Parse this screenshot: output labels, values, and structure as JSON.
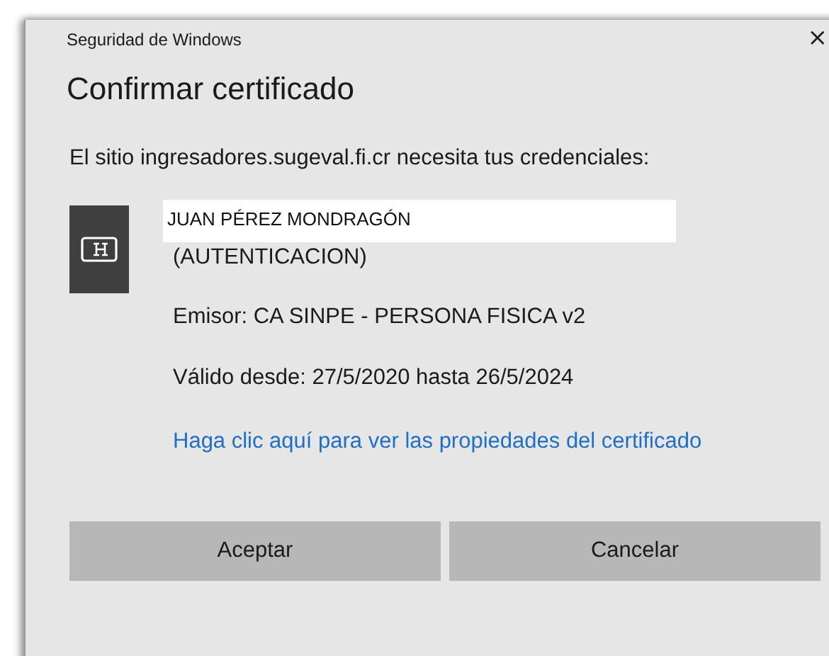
{
  "window": {
    "title": "Seguridad de Windows",
    "close": "×"
  },
  "heading": "Confirmar certificado",
  "message": "El sitio ingresadores.sugeval.fi.cr necesita tus credenciales:",
  "certificate": {
    "name": "JUAN PÉREZ MONDRAGÓN",
    "purpose": "(AUTENTICACION)",
    "issuer": "Emisor: CA SINPE - PERSONA FISICA v2",
    "validity": "Válido desde: 27/5/2020 hasta 26/5/2024",
    "properties_link": "Haga clic aquí para ver las propiedades del certificado"
  },
  "buttons": [
    "Aceptar",
    "Cancelar"
  ]
}
